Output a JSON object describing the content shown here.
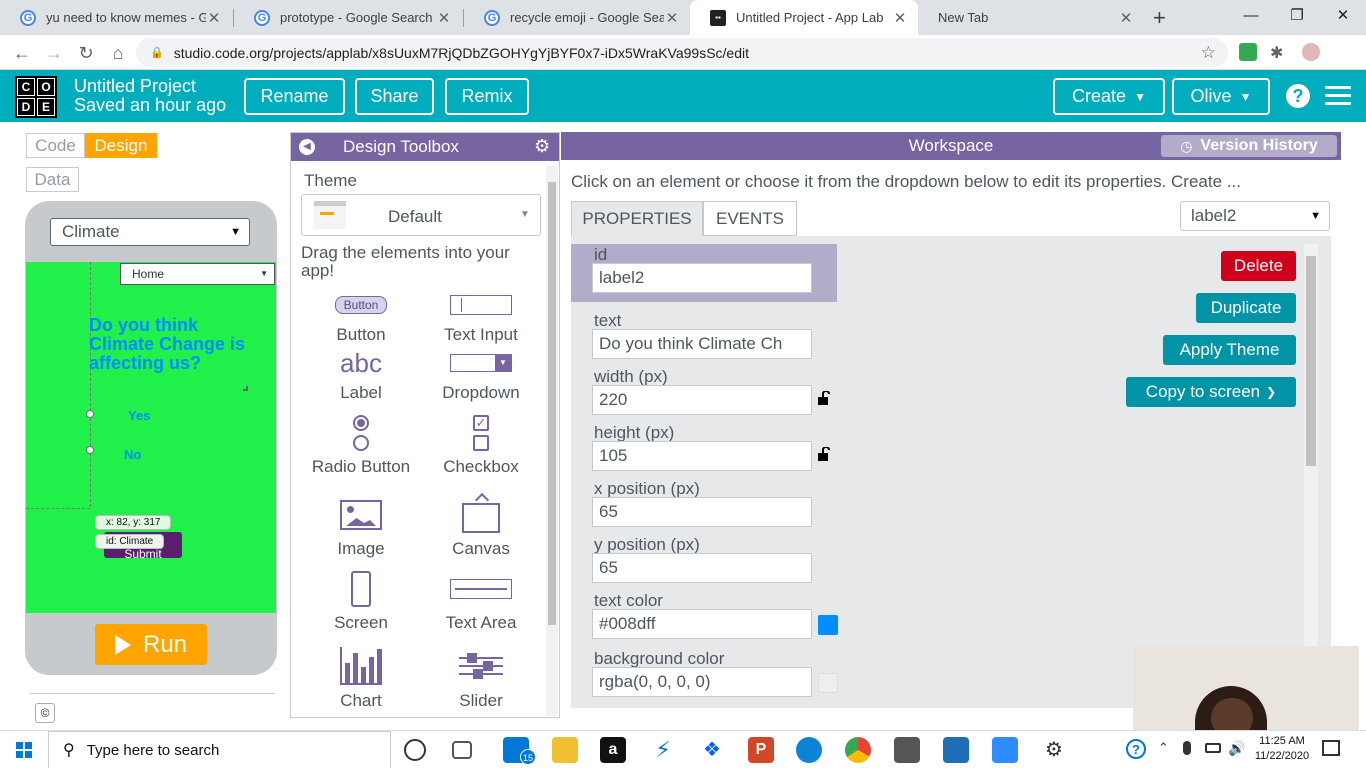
{
  "browser": {
    "tabs": [
      {
        "title": "yu need to know memes - Go",
        "favicon": "google-icon"
      },
      {
        "title": "prototype - Google Search",
        "favicon": "google-icon"
      },
      {
        "title": "recycle emoji - Google Search",
        "favicon": "google-icon"
      },
      {
        "title": "Untitled Project - App Lab",
        "favicon": "code-org-icon"
      },
      {
        "title": "New Tab",
        "favicon": ""
      }
    ],
    "url": "studio.code.org/projects/applab/x8sUuxM7RjQDbZGOHYgYjBYF0x7-iDx5WraKVa99sSc/edit"
  },
  "header": {
    "logo_letters": [
      "C",
      "O",
      "D",
      "E"
    ],
    "project_name": "Untitled Project",
    "saved_status": "Saved an hour ago",
    "rename": "Rename",
    "share": "Share",
    "remix": "Remix",
    "create": "Create",
    "user": "Olive",
    "accent": "#00adbc"
  },
  "modes": {
    "code": "Code",
    "design": "Design",
    "data": "Data"
  },
  "app_preview": {
    "screen_select": "Climate",
    "home_dropdown": "Home",
    "question": "Do you think Climate Change is affecting us?",
    "yes": "Yes",
    "no": "No",
    "coords_tag": "x: 82, y: 317",
    "id_tag": "id: Climate",
    "behind_tag_text": "Submit",
    "screen_color": "#22f04a",
    "run": "Run",
    "copyright": "©"
  },
  "toolbox": {
    "title": "Design Toolbox",
    "theme_label": "Theme",
    "theme_value": "Default",
    "drag_hint": "Drag the elements into your app!",
    "button_preview": "Button",
    "label_preview": "abc",
    "items": [
      "Button",
      "Text Input",
      "Label",
      "Dropdown",
      "Radio Button",
      "Checkbox",
      "Image",
      "Canvas",
      "Screen",
      "Text Area",
      "Chart",
      "Slider"
    ]
  },
  "workspace": {
    "title": "Workspace",
    "version_history": "Version History",
    "instructions": "Click on an element or choose it from the dropdown below to edit its properties. Create ...",
    "tab_properties": "PROPERTIES",
    "tab_events": "EVENTS",
    "element_select": "label2",
    "delete": "Delete",
    "duplicate": "Duplicate",
    "apply_theme": "Apply Theme",
    "copy_to_screen": "Copy to screen",
    "properties": {
      "id_label": "id",
      "id_value": "label2",
      "text_label": "text",
      "text_value": "Do you think Climate Ch",
      "width_label": "width (px)",
      "width_value": "220",
      "height_label": "height (px)",
      "height_value": "105",
      "x_label": "x position (px)",
      "x_value": "65",
      "y_label": "y position (px)",
      "y_value": "65",
      "text_color_label": "text color",
      "text_color_value": "#008dff",
      "bg_color_label": "background color",
      "bg_color_value": "rgba(0, 0, 0, 0)"
    }
  },
  "taskbar": {
    "search_placeholder": "Type here to search",
    "time": "11:25 AM",
    "date": "11/22/2020",
    "mail_badge": "15"
  }
}
